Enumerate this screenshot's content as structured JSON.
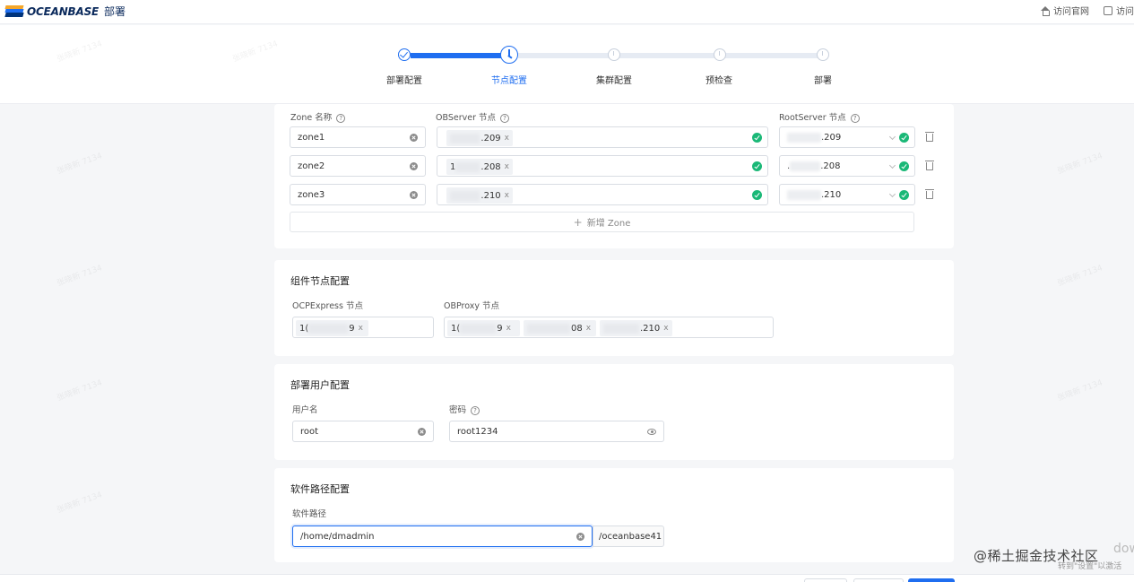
{
  "header": {
    "brand": "OCEANBASE",
    "app_title": "部署",
    "links": [
      "访问官网",
      "访问"
    ]
  },
  "stepper": {
    "steps": [
      "部署配置",
      "节点配置",
      "集群配置",
      "预检查",
      "部署"
    ],
    "current_index": 1
  },
  "zones_card": {
    "labels": {
      "zone_name": "Zone 名称",
      "observer": "OBServer 节点",
      "rootserver": "RootServer 节点"
    },
    "rows": [
      {
        "zone": "zone1",
        "observer_ip_tail": ".209",
        "rootserver_ip_tail": ".209"
      },
      {
        "zone": "zone2",
        "observer_ip_tail": ".208",
        "rootserver_ip_tail": ".208"
      },
      {
        "zone": "zone3",
        "observer_ip_tail": ".210",
        "rootserver_ip_tail": ".210"
      }
    ],
    "add_zone_label": "新增 Zone",
    "observer_prefixes": [
      "",
      "1",
      ""
    ],
    "rootserver_prefixes": [
      "",
      "",
      "."
    ]
  },
  "component_card": {
    "title": "组件节点配置",
    "ocp_label": "OCPExpress 节点",
    "obproxy_label": "OBProxy 节点",
    "ocp_tag": {
      "prefix": "1(",
      "tail": "9"
    },
    "obproxy_tags": [
      {
        "prefix": "1(",
        "tail": "9"
      },
      {
        "prefix": "",
        "tail": "08"
      },
      {
        "prefix": "",
        "tail": ".210"
      }
    ]
  },
  "user_card": {
    "title": "部署用户配置",
    "username_label": "用户名",
    "username_value": "root",
    "password_label": "密码",
    "password_value": "root1234"
  },
  "path_card": {
    "title": "软件路径配置",
    "path_label": "软件路径",
    "path_value": "/home/dmadmin",
    "path_suffix": "/oceanbase41"
  },
  "watermark_text": "张晓新 7134",
  "site_mark": "@稀土掘金技术社区",
  "windows_activation": {
    "line1": "转到\"设置\"以激活",
    "line2": "dow"
  },
  "colors": {
    "primary": "#1f6ef0",
    "success": "#1ab877",
    "brand_dark": "#0b2a5c"
  }
}
